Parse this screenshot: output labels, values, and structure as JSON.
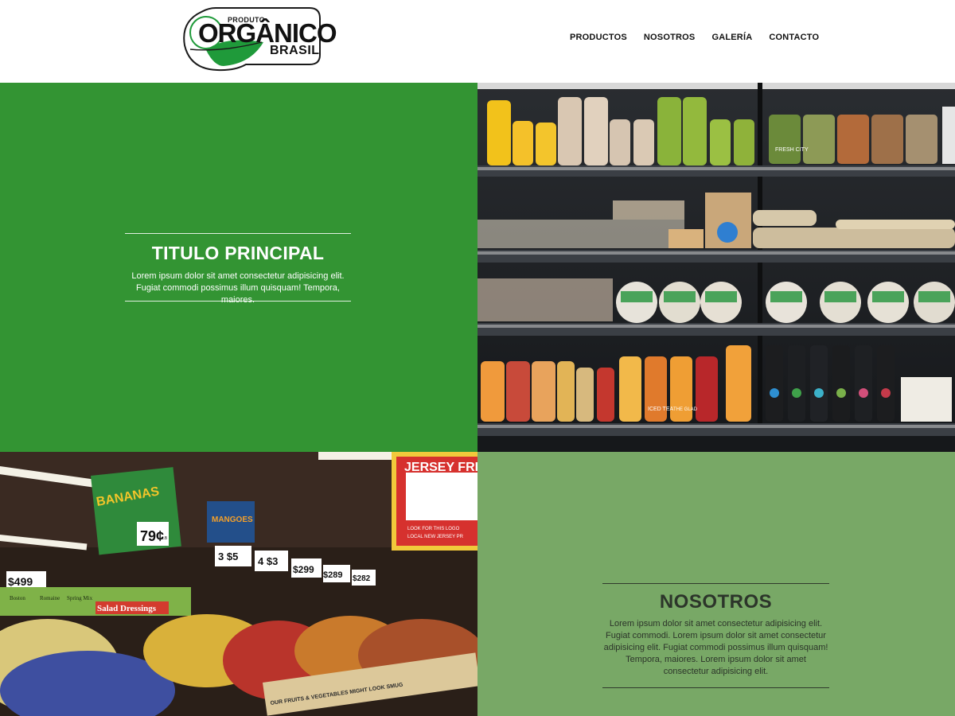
{
  "header": {
    "logo": {
      "line1": "PRODUTO",
      "line2": "ORGÂNICO",
      "line3": "BRASIL"
    },
    "nav": [
      {
        "label": "PRODUCTOS"
      },
      {
        "label": "NOSOTROS"
      },
      {
        "label": "GALERÍA"
      },
      {
        "label": "CONTACTO"
      }
    ]
  },
  "hero": {
    "title": "TITULO PRINCIPAL",
    "text": "Lorem ipsum dolor sit amet consectetur adipisicing elit. Fugiat commodi possimus illum quisquam! Tempora, maiores."
  },
  "shelves": {
    "tags": [
      "ICED TEA",
      "THE GLAD",
      "FRESH CITY"
    ]
  },
  "produce": {
    "signs": [
      "BANANAS",
      "79¢",
      "LB",
      "MANGOES",
      "3 $5",
      "4 $3",
      "$299",
      "$499",
      "$289",
      "$282",
      "JERSEY FRESH",
      "LOOK FOR THIS LOGO",
      "LOCAL NEW JERSEY PR",
      "Salad Dressings",
      "Boston",
      "Romaine",
      "Spring Mix",
      "OUR FRUITS & VEGETABLES MIGHT LOOK SMUG"
    ]
  },
  "about": {
    "title": "NOSOTROS",
    "text": "Lorem ipsum dolor sit amet consectetur adipisicing elit. Fugiat commodi. Lorem ipsum dolor sit amet consectetur adipisicing elit. Fugiat commodi possimus illum quisquam! Tempora, maiores. Lorem ipsum dolor sit amet consectetur adipisicing elit."
  },
  "colors": {
    "hero_green": "#339433",
    "about_green": "#78a866",
    "logo_green": "#1f9a3a"
  }
}
